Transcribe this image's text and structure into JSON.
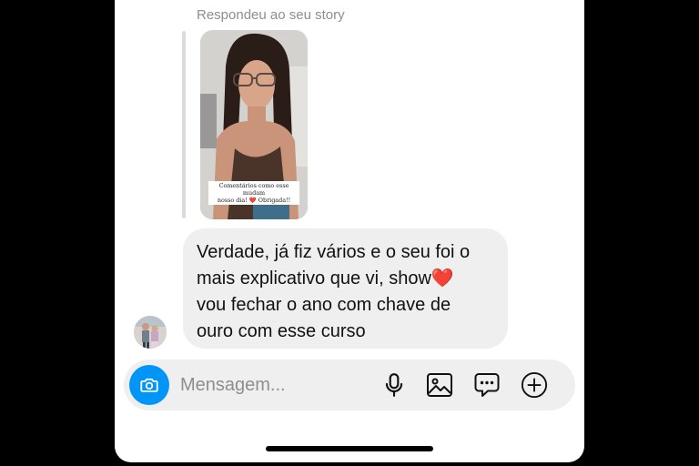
{
  "thread": {
    "reply_caption": "Respondeu ao seu story",
    "story": {
      "sticker_line1": "Comentários como esse mudam",
      "sticker_line2": "nosso dia! ❤️ Obrigada!!"
    },
    "message": {
      "line1": "Verdade, já fiz vários e o seu foi o",
      "line2_text": "mais explicativo que vi, show",
      "line2_emoji": "❤️",
      "line3": "vou fechar o ano com chave de",
      "line4": "ouro com esse curso"
    }
  },
  "composer": {
    "placeholder": "Mensagem...",
    "icons": [
      "camera-icon",
      "microphone-icon",
      "gallery-icon",
      "sticker-icon",
      "plus-icon"
    ],
    "accent_color": "#0095f6"
  }
}
